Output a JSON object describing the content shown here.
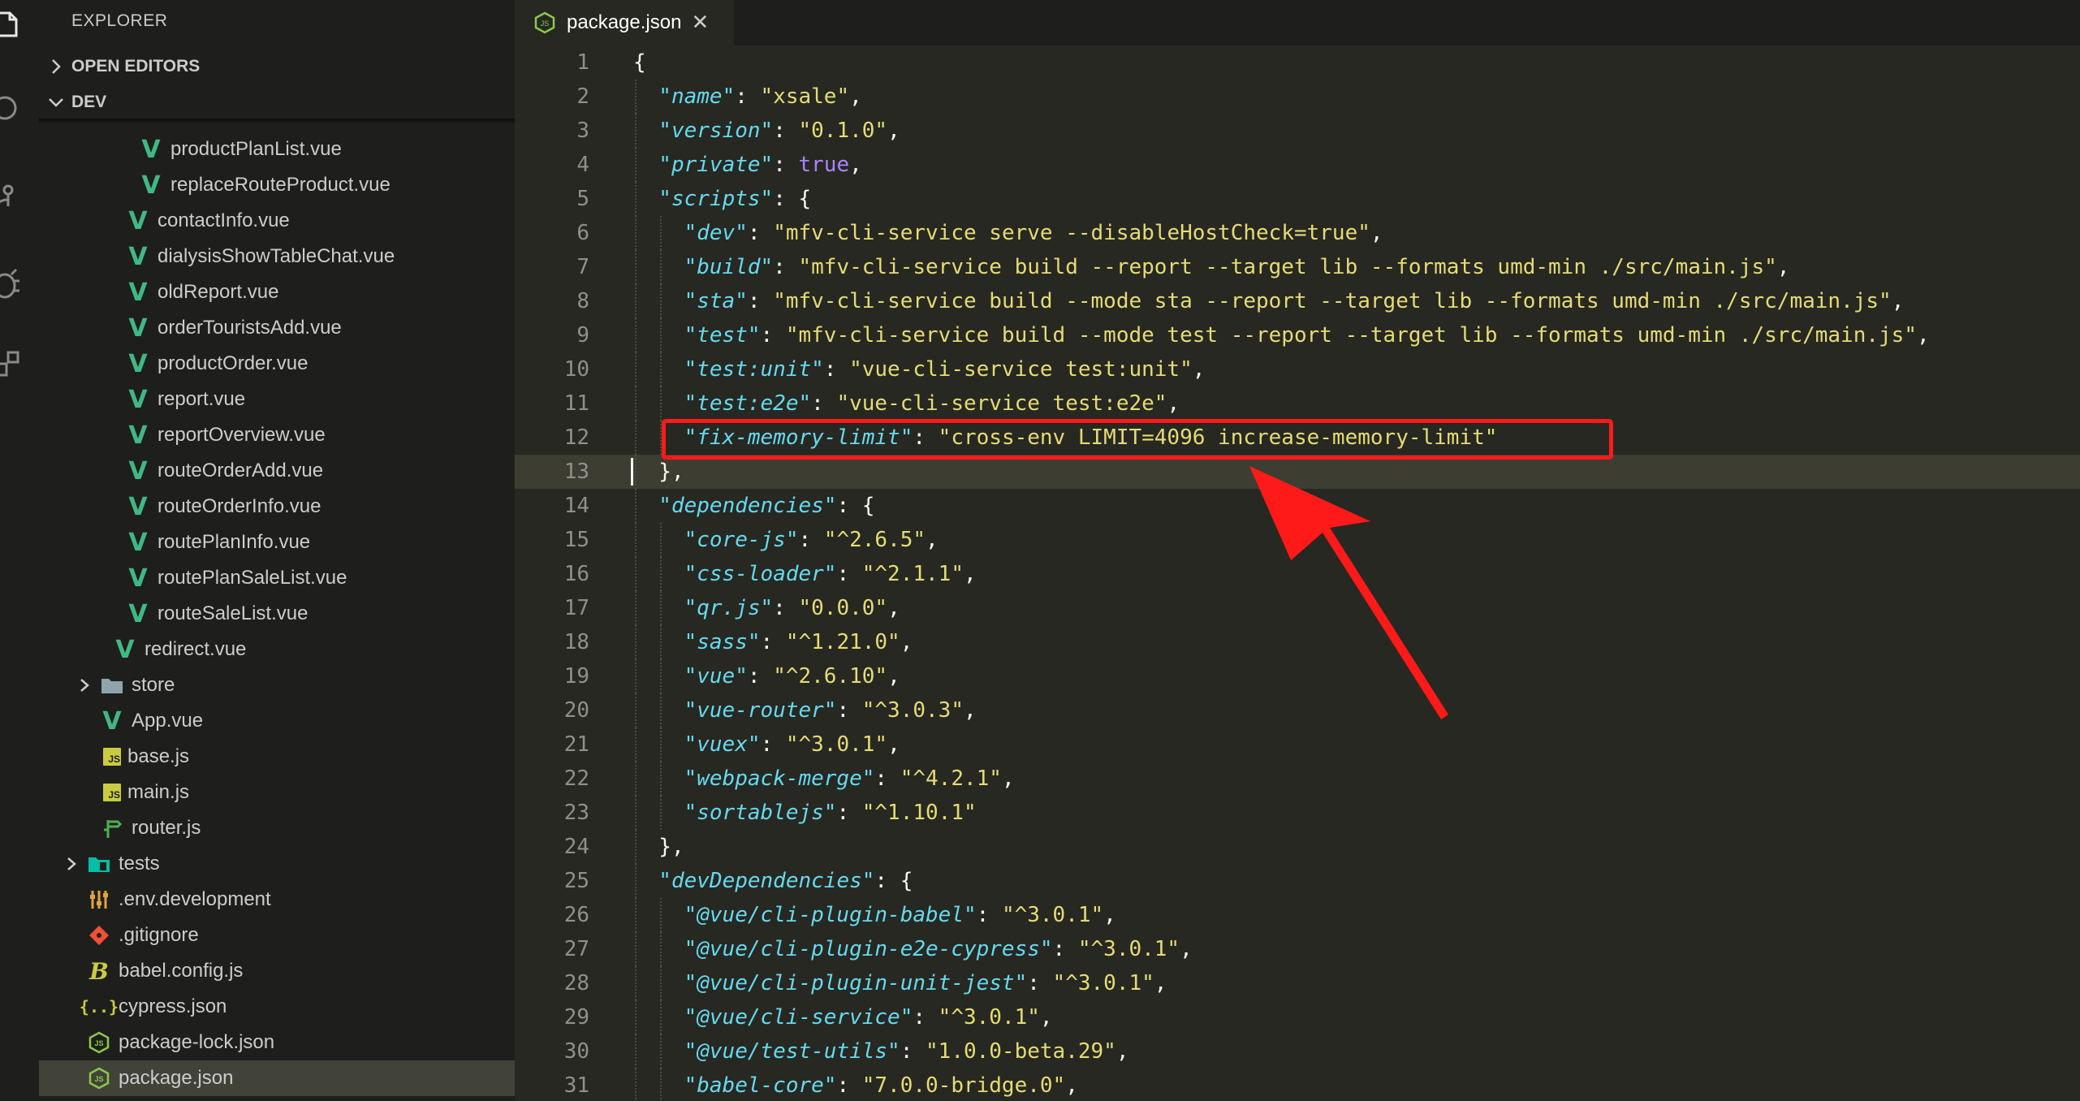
{
  "sidebar": {
    "title": "EXPLORER",
    "sections": {
      "open_editors": "OPEN EDITORS",
      "dev": "DEV"
    },
    "items": [
      {
        "label": "productPlanList.vue",
        "icon": "vue-icon",
        "indent": 5
      },
      {
        "label": "replaceRouteProduct.vue",
        "icon": "vue-icon",
        "indent": 5
      },
      {
        "label": "contactInfo.vue",
        "icon": "vue-icon",
        "indent": 4
      },
      {
        "label": "dialysisShowTableChat.vue",
        "icon": "vue-icon",
        "indent": 4
      },
      {
        "label": "oldReport.vue",
        "icon": "vue-icon",
        "indent": 4
      },
      {
        "label": "orderTouristsAdd.vue",
        "icon": "vue-icon",
        "indent": 4
      },
      {
        "label": "productOrder.vue",
        "icon": "vue-icon",
        "indent": 4
      },
      {
        "label": "report.vue",
        "icon": "vue-icon",
        "indent": 4
      },
      {
        "label": "reportOverview.vue",
        "icon": "vue-icon",
        "indent": 4
      },
      {
        "label": "routeOrderAdd.vue",
        "icon": "vue-icon",
        "indent": 4
      },
      {
        "label": "routeOrderInfo.vue",
        "icon": "vue-icon",
        "indent": 4
      },
      {
        "label": "routePlanInfo.vue",
        "icon": "vue-icon",
        "indent": 4
      },
      {
        "label": "routePlanSaleList.vue",
        "icon": "vue-icon",
        "indent": 4
      },
      {
        "label": "routeSaleList.vue",
        "icon": "vue-icon",
        "indent": 4
      },
      {
        "label": "redirect.vue",
        "icon": "vue-icon",
        "indent": 3
      },
      {
        "label": "store",
        "icon": "folder-icon",
        "indent": 2,
        "twistie": true
      },
      {
        "label": "App.vue",
        "icon": "vue-icon",
        "indent": 2
      },
      {
        "label": "base.js",
        "icon": "js-icon",
        "indent": 2
      },
      {
        "label": "main.js",
        "icon": "js-icon",
        "indent": 2
      },
      {
        "label": "router.js",
        "icon": "router-icon",
        "indent": 2
      },
      {
        "label": "tests",
        "icon": "test-folder-icon",
        "indent": 1,
        "twistie": true
      },
      {
        "label": ".env.development",
        "icon": "settings-icon",
        "indent": 1
      },
      {
        "label": ".gitignore",
        "icon": "git-icon",
        "indent": 1
      },
      {
        "label": "babel.config.js",
        "icon": "babel-icon",
        "indent": 1
      },
      {
        "label": "cypress.json",
        "icon": "json-icon",
        "indent": 1
      },
      {
        "label": "package-lock.json",
        "icon": "node-icon",
        "indent": 1
      },
      {
        "label": "package.json",
        "icon": "node-icon",
        "indent": 1,
        "selected": true
      }
    ]
  },
  "tab": {
    "label": "package.json",
    "close": "✕"
  },
  "editor": {
    "current_line": 13,
    "lines": [
      {
        "n": "1",
        "i": 0,
        "t": [
          [
            "p",
            "{"
          ]
        ]
      },
      {
        "n": "2",
        "i": 1,
        "t": [
          [
            "k",
            "\"name\""
          ],
          [
            "p",
            ": "
          ],
          [
            "s",
            "\"xsale\""
          ],
          [
            "p",
            ","
          ]
        ]
      },
      {
        "n": "3",
        "i": 1,
        "t": [
          [
            "k",
            "\"version\""
          ],
          [
            "p",
            ": "
          ],
          [
            "s",
            "\"0.1.0\""
          ],
          [
            "p",
            ","
          ]
        ]
      },
      {
        "n": "4",
        "i": 1,
        "t": [
          [
            "k",
            "\"private\""
          ],
          [
            "p",
            ": "
          ],
          [
            "b",
            "true"
          ],
          [
            "p",
            ","
          ]
        ]
      },
      {
        "n": "5",
        "i": 1,
        "t": [
          [
            "k",
            "\"scripts\""
          ],
          [
            "p",
            ": {"
          ]
        ]
      },
      {
        "n": "6",
        "i": 2,
        "t": [
          [
            "k",
            "\"dev\""
          ],
          [
            "p",
            ": "
          ],
          [
            "s",
            "\"mfv-cli-service serve --disableHostCheck=true\""
          ],
          [
            "p",
            ","
          ]
        ]
      },
      {
        "n": "7",
        "i": 2,
        "t": [
          [
            "k",
            "\"build\""
          ],
          [
            "p",
            ": "
          ],
          [
            "s",
            "\"mfv-cli-service build --report --target lib --formats umd-min ./src/main.js\""
          ],
          [
            "p",
            ","
          ]
        ]
      },
      {
        "n": "8",
        "i": 2,
        "t": [
          [
            "k",
            "\"sta\""
          ],
          [
            "p",
            ": "
          ],
          [
            "s",
            "\"mfv-cli-service build --mode sta --report --target lib --formats umd-min ./src/main.js\""
          ],
          [
            "p",
            ","
          ]
        ]
      },
      {
        "n": "9",
        "i": 2,
        "t": [
          [
            "k",
            "\"test\""
          ],
          [
            "p",
            ": "
          ],
          [
            "s",
            "\"mfv-cli-service build --mode test --report --target lib --formats umd-min ./src/main.js\""
          ],
          [
            "p",
            ","
          ]
        ]
      },
      {
        "n": "10",
        "i": 2,
        "t": [
          [
            "k",
            "\"test:unit\""
          ],
          [
            "p",
            ": "
          ],
          [
            "s",
            "\"vue-cli-service test:unit\""
          ],
          [
            "p",
            ","
          ]
        ]
      },
      {
        "n": "11",
        "i": 2,
        "t": [
          [
            "k",
            "\"test:e2e\""
          ],
          [
            "p",
            ": "
          ],
          [
            "s",
            "\"vue-cli-service test:e2e\""
          ],
          [
            "p",
            ","
          ]
        ]
      },
      {
        "n": "12",
        "i": 2,
        "t": [
          [
            "k",
            "\"fix-memory-limit\""
          ],
          [
            "p",
            ": "
          ],
          [
            "s",
            "\"cross-env LIMIT=4096 increase-memory-limit\""
          ]
        ]
      },
      {
        "n": "13",
        "i": 1,
        "t": [
          [
            "p",
            "},"
          ]
        ]
      },
      {
        "n": "14",
        "i": 1,
        "t": [
          [
            "k",
            "\"dependencies\""
          ],
          [
            "p",
            ": {"
          ]
        ]
      },
      {
        "n": "15",
        "i": 2,
        "t": [
          [
            "k",
            "\"core-js\""
          ],
          [
            "p",
            ": "
          ],
          [
            "s",
            "\"^2.6.5\""
          ],
          [
            "p",
            ","
          ]
        ]
      },
      {
        "n": "16",
        "i": 2,
        "t": [
          [
            "k",
            "\"css-loader\""
          ],
          [
            "p",
            ": "
          ],
          [
            "s",
            "\"^2.1.1\""
          ],
          [
            "p",
            ","
          ]
        ]
      },
      {
        "n": "17",
        "i": 2,
        "t": [
          [
            "k",
            "\"qr.js\""
          ],
          [
            "p",
            ": "
          ],
          [
            "s",
            "\"0.0.0\""
          ],
          [
            "p",
            ","
          ]
        ]
      },
      {
        "n": "18",
        "i": 2,
        "t": [
          [
            "k",
            "\"sass\""
          ],
          [
            "p",
            ": "
          ],
          [
            "s",
            "\"^1.21.0\""
          ],
          [
            "p",
            ","
          ]
        ]
      },
      {
        "n": "19",
        "i": 2,
        "t": [
          [
            "k",
            "\"vue\""
          ],
          [
            "p",
            ": "
          ],
          [
            "s",
            "\"^2.6.10\""
          ],
          [
            "p",
            ","
          ]
        ]
      },
      {
        "n": "20",
        "i": 2,
        "t": [
          [
            "k",
            "\"vue-router\""
          ],
          [
            "p",
            ": "
          ],
          [
            "s",
            "\"^3.0.3\""
          ],
          [
            "p",
            ","
          ]
        ]
      },
      {
        "n": "21",
        "i": 2,
        "t": [
          [
            "k",
            "\"vuex\""
          ],
          [
            "p",
            ": "
          ],
          [
            "s",
            "\"^3.0.1\""
          ],
          [
            "p",
            ","
          ]
        ]
      },
      {
        "n": "22",
        "i": 2,
        "t": [
          [
            "k",
            "\"webpack-merge\""
          ],
          [
            "p",
            ": "
          ],
          [
            "s",
            "\"^4.2.1\""
          ],
          [
            "p",
            ","
          ]
        ]
      },
      {
        "n": "23",
        "i": 2,
        "t": [
          [
            "k",
            "\"sortablejs\""
          ],
          [
            "p",
            ": "
          ],
          [
            "s",
            "\"^1.10.1\""
          ]
        ]
      },
      {
        "n": "24",
        "i": 1,
        "t": [
          [
            "p",
            "},"
          ]
        ]
      },
      {
        "n": "25",
        "i": 1,
        "t": [
          [
            "k",
            "\"devDependencies\""
          ],
          [
            "p",
            ": {"
          ]
        ]
      },
      {
        "n": "26",
        "i": 2,
        "t": [
          [
            "k",
            "\"@vue/cli-plugin-babel\""
          ],
          [
            "p",
            ": "
          ],
          [
            "s",
            "\"^3.0.1\""
          ],
          [
            "p",
            ","
          ]
        ]
      },
      {
        "n": "27",
        "i": 2,
        "t": [
          [
            "k",
            "\"@vue/cli-plugin-e2e-cypress\""
          ],
          [
            "p",
            ": "
          ],
          [
            "s",
            "\"^3.0.1\""
          ],
          [
            "p",
            ","
          ]
        ]
      },
      {
        "n": "28",
        "i": 2,
        "t": [
          [
            "k",
            "\"@vue/cli-plugin-unit-jest\""
          ],
          [
            "p",
            ": "
          ],
          [
            "s",
            "\"^3.0.1\""
          ],
          [
            "p",
            ","
          ]
        ]
      },
      {
        "n": "29",
        "i": 2,
        "t": [
          [
            "k",
            "\"@vue/cli-service\""
          ],
          [
            "p",
            ": "
          ],
          [
            "s",
            "\"^3.0.1\""
          ],
          [
            "p",
            ","
          ]
        ]
      },
      {
        "n": "30",
        "i": 2,
        "t": [
          [
            "k",
            "\"@vue/test-utils\""
          ],
          [
            "p",
            ": "
          ],
          [
            "s",
            "\"1.0.0-beta.29\""
          ],
          [
            "p",
            ","
          ]
        ]
      },
      {
        "n": "31",
        "i": 2,
        "t": [
          [
            "k",
            "\"babel-core\""
          ],
          [
            "p",
            ": "
          ],
          [
            "s",
            "\"7.0.0-bridge.0\""
          ],
          [
            "p",
            ","
          ]
        ]
      }
    ]
  },
  "colors": {
    "key": "#66d9ef",
    "string": "#e6db74",
    "boolean": "#ae81ff",
    "punct": "#f8f8f2",
    "vue": "#41b883",
    "annotation": "#ff1a1a"
  }
}
